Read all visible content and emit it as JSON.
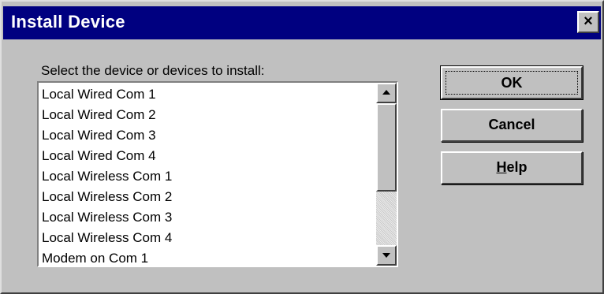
{
  "window": {
    "title": "Install Device",
    "close_glyph": "×"
  },
  "prompt": "Select the device or devices to install:",
  "devices": [
    "Local Wired Com 1",
    "Local Wired Com 2",
    "Local Wired Com 3",
    "Local Wired Com 4",
    "Local Wireless Com 1",
    "Local Wireless Com 2",
    "Local Wireless Com 3",
    "Local Wireless Com 4",
    "Modem on Com 1"
  ],
  "buttons": {
    "ok": "OK",
    "cancel": "Cancel",
    "help_mnemonic": "H",
    "help_rest": "elp"
  },
  "icons": {
    "scroll_up": "arrow-up-icon",
    "scroll_down": "arrow-down-icon",
    "close": "close-icon"
  },
  "colors": {
    "titlebar": "#000080",
    "face": "#c0c0c0"
  }
}
